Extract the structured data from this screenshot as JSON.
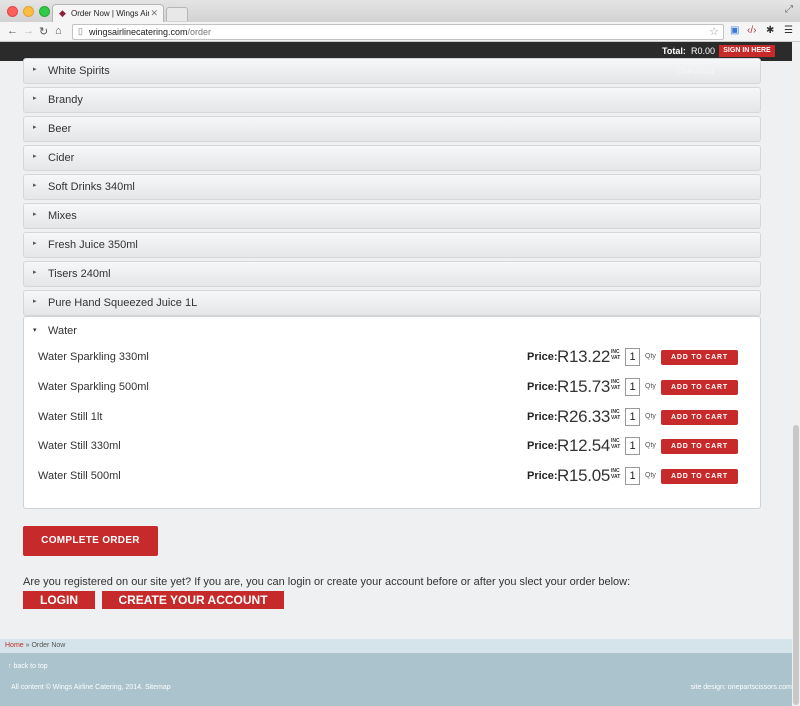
{
  "browser": {
    "tab_title": "Order Now | Wings Airline",
    "url_host": "wingsairlinecatering.com",
    "url_path": "/order"
  },
  "header": {
    "total_label": "Total:",
    "total_value": "R0.00",
    "signin_label": "SIGN IN HERE",
    "checkout_label": "Checkout"
  },
  "categories": [
    "White Spirits",
    "Brandy",
    "Beer",
    "Cider",
    "Soft Drinks 340ml",
    "Mixes",
    "Fresh Juice 350ml",
    "Tisers 240ml",
    "Pure Hand Squeezed Juice 1L"
  ],
  "water_section": {
    "title": "Water",
    "price_label": "Price:",
    "incvat_label": "INC VAT",
    "qty_label": "Qty",
    "add_label": "ADD TO CART",
    "products": [
      {
        "name": "Water Sparkling 330ml",
        "price": "R13.22",
        "qty": "1"
      },
      {
        "name": "Water Sparkling 500ml",
        "price": "R15.73",
        "qty": "1"
      },
      {
        "name": "Water Still 1lt",
        "price": "R26.33",
        "qty": "1"
      },
      {
        "name": "Water Still 330ml",
        "price": "R12.54",
        "qty": "1"
      },
      {
        "name": "Water Still 500ml",
        "price": "R15.05",
        "qty": "1"
      }
    ]
  },
  "actions": {
    "complete_order": "COMPLETE ORDER",
    "registered_text": "Are you registered on our site yet? If you are, you can login or create your account before or after you slect your order below:",
    "login": "LOGIN",
    "create_account": "CREATE YOUR ACCOUNT"
  },
  "breadcrumb": {
    "home": "Home",
    "separator": " » ",
    "current": "Order Now"
  },
  "footer": {
    "back_to_top": "back to top",
    "copyright": "All content © Wings Airline Catering, 2014. Sitemap",
    "design_credit": "site design: onepartscissors.com"
  },
  "colors": {
    "accent": "#c62a2a",
    "header_bg": "#2b2b2b",
    "footer_bg": "#aac3cc"
  }
}
